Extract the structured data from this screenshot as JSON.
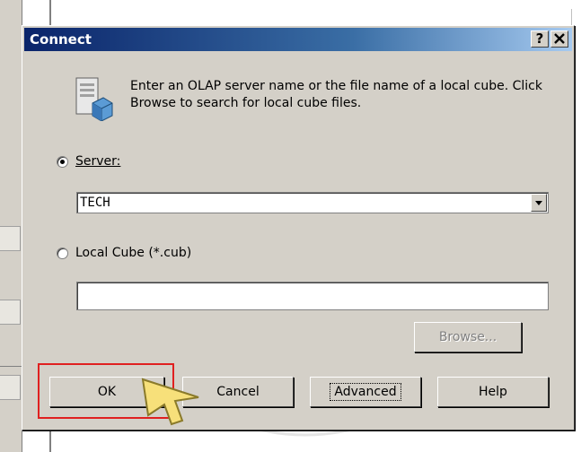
{
  "dialog": {
    "title": "Connect",
    "help_label": "?",
    "close_label": "×",
    "description": "Enter an OLAP server name or the file name of a local cube. Click Browse to search for local cube files.",
    "server_radio": {
      "label": "Server:",
      "checked": true
    },
    "server_combo": {
      "value": "TECH"
    },
    "localcube_radio": {
      "label": "Local Cube (*.cub)",
      "checked": false
    },
    "localcube_input": {
      "value": ""
    },
    "browse_label": "Browse...",
    "buttons": {
      "ok": "OK",
      "cancel": "Cancel",
      "advanced": "Advanced",
      "help": "Help"
    }
  },
  "colors": {
    "title_start": "#0a246a",
    "highlight": "#e02020",
    "pointer": "#f7e07a"
  }
}
